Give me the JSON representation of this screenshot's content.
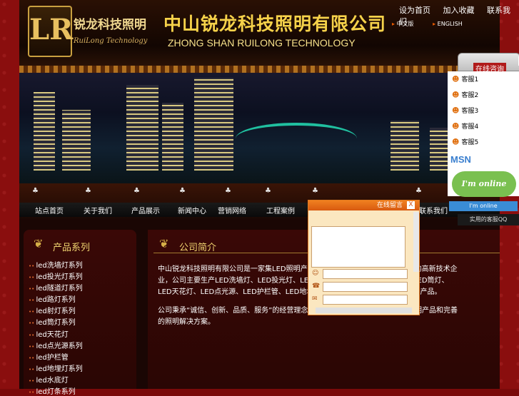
{
  "header": {
    "logo_mark": "LR",
    "logo_cn": "锐龙科技照明",
    "logo_en": "RuiLong Technology",
    "company_cn": "中山锐龙科技照明有限公司",
    "company_en": "ZHONG SHAN RUILONG TECHNOLOGY",
    "topnav": [
      "设为首页",
      "加入收藏",
      "联系我们"
    ],
    "lang": [
      "中文版",
      "ENGLISH"
    ]
  },
  "nav": {
    "items": [
      "站点首页",
      "关于我们",
      "产品展示",
      "新闻中心",
      "营销网络",
      "工程案例",
      "联系我们"
    ]
  },
  "sidebar": {
    "title": "产品系列",
    "items": [
      "led洗墙灯系列",
      "led投光灯系列",
      "led隧道灯系列",
      "led路灯系列",
      "led射灯系列",
      "led筒灯系列",
      "led天花灯",
      "led点光源系列",
      "led护栏管",
      "led地埋灯系列",
      "led水底灯",
      "led灯条系列"
    ]
  },
  "content": {
    "title": "公司简介",
    "paragraphs": [
      "中山锐龙科技照明有限公司是一家集LED照明产品研发、生产、销售和服务于一体的高新技术企业，公司主要生产LED洗墙灯、LED投光灯、LED隧道灯、LED路灯、LED射灯、LED筒灯、LED天花灯、LED点光源、LED护栏管、LED地埋灯、LED水底灯、LED灯条等系列产品。",
      "公司秉承“诚信、创新、品质、服务”的经营理念，致力于为客户提供优质的LED照明产品和完善的照明解决方案。"
    ]
  },
  "qq": {
    "header_label": "在线咨询",
    "close": "×",
    "contacts": [
      "客服1",
      "客服2",
      "客服3",
      "客服4",
      "客服5"
    ],
    "msn": "MSN",
    "online": "I'm online",
    "online_small": "I'm online",
    "footer": "实用的客服QQ"
  },
  "chat": {
    "title": "在线留言",
    "close": "X"
  }
}
